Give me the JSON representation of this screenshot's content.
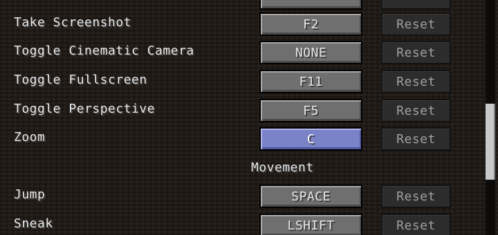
{
  "top_row": {
    "key": "",
    "reset": ""
  },
  "controls": [
    {
      "action": "Take Screenshot",
      "key": "F2",
      "reset": "Reset"
    },
    {
      "action": "Toggle Cinematic Camera",
      "key": "NONE",
      "reset": "Reset"
    },
    {
      "action": "Toggle Fullscreen",
      "key": "F11",
      "reset": "Reset"
    },
    {
      "action": "Toggle Perspective",
      "key": "F5",
      "reset": "Reset"
    },
    {
      "action": "Zoom",
      "key": "C",
      "reset": "Reset",
      "selected": true
    }
  ],
  "movement": {
    "header": "Movement",
    "controls": [
      {
        "action": "Jump",
        "key": "SPACE",
        "reset": "Reset"
      },
      {
        "action": "Sneak",
        "key": "LSHIFT",
        "reset": "Reset"
      }
    ]
  },
  "colors": {
    "selected_key": "#7a83c8",
    "key_button": "#6f6f6f",
    "reset_button": "#2c2c2c",
    "background": "#201915"
  }
}
